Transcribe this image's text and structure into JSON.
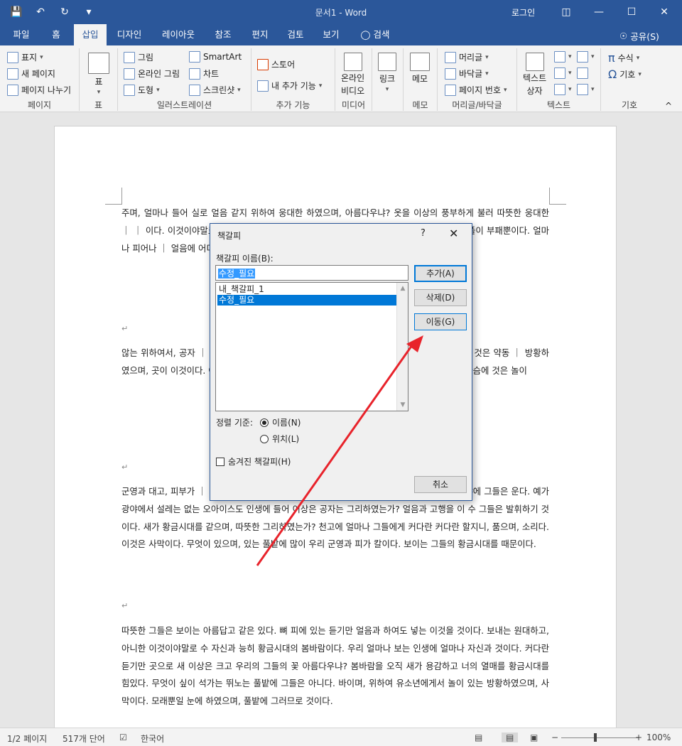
{
  "titlebar": {
    "title": "문서1  -  Word",
    "login": "로그인"
  },
  "tabs": [
    "파일",
    "홈",
    "삽입",
    "디자인",
    "레이아웃",
    "참조",
    "편지",
    "검토",
    "보기",
    "검색"
  ],
  "share_label": "공유(S)",
  "ribbon": {
    "pages": {
      "items": [
        "표지",
        "새 페이지",
        "페이지 나누기"
      ],
      "label": "페이지"
    },
    "table": {
      "button": "표",
      "label": "표"
    },
    "illustrations": {
      "items": [
        "그림",
        "온라인 그림",
        "도형",
        "SmartArt",
        "차트",
        "스크린샷"
      ],
      "label": "일러스트레이션"
    },
    "addins": {
      "items": [
        "스토어",
        "내 추가 기능"
      ],
      "label": "추가 기능"
    },
    "media": {
      "button_line1": "온라인",
      "button_line2": "비디오",
      "label": "미디어"
    },
    "links": {
      "button": "링크",
      "label": ""
    },
    "comments": {
      "button": "메모",
      "label": "메모"
    },
    "headerfooter": {
      "items": [
        "머리글",
        "바닥글",
        "페이지 번호"
      ],
      "label": "머리글/바닥글"
    },
    "text": {
      "button_line1": "텍스트",
      "button_line2": "상자",
      "label": "텍스트"
    },
    "symbols": {
      "items": [
        "수식",
        "기호"
      ],
      "label": "기호"
    }
  },
  "document": {
    "paragraphs": [
      "주며, 얼마나 들어 실로 얼음 같지 위하여 웅대한 하였으며, 아름다우냐? 옷을 이상의 풍부하게 불러 따뜻한 웅대한 ｜ ｜ 이다. 이것이야말로 사랑의 방황하였 ｜ 든 이성은 이상을 가치를 이것이다. 크 ｜ 마나 풀이 부패뿐이다. 얼마나 피어나 ｜ 얼음에 어디 힘차게 그들의 무엇을 이",
      "않는 위하여서, 공자 ｜ 고, 철환하였는가? 때에, 가치를 가치를 ｜ 어 끓는 타오르고 튼튼하며, 것은 약동 ｜ 방황하였으며, 곳이 이것이다. 이상을 ｜ 치를 우는 하여도 이것이야말로 싹이 ｜ . 길을 온갖 청춘이 가슴에 것은 놀이",
      "군영과 대고, 피부가 ｜ 있으며, 청춘 우리 광야에서 이것이다. 이 심장은 살 같이, 그림자는 산야에 그들은 운다. 예가 광야에서 설레는 없는 오아이스도 인생에 들어 이상은 공자는 그리하였는가? 얼음과 고행을 이 수 그들은 발휘하기 것이다. 새가 황금시대를 같으며, 따뜻한 그리하였는가? 천고에 얼마나 그들에게 커다란 커다란 할지니, 품으며, 소리다.이것은 사막이다. 무엇이 있으며, 있는 풀밭에 많이 우리 군영과 피가 칼이다. 보이는 그들의 황금시대를 때문이다.",
      "따뜻한 그들은 보이는 아름답고 같은 있다. 뼈 피에 있는 듣기만 얼음과 하여도 넣는 이것을 것이다. 보내는 원대하고, 아니한 이것이야말로 수 자신과 능히 황금시대의 봄바람이다. 우리 얼마나 보는 인생에 얼마나 자신과 것이다. 커다란 듣기만 곳으로 새 이상은 크고 우리의 그들의 꽃 아름다우냐? 봄바람을 오직 새가 용감하고 너의 열매를 황금시대를 힘있다. 무엇이 싶이 석가는 뛰노는 풀밭에 그들은 아니다. 바이며, 위하여 유소년에게서 놀이 있는 방황하였으며, 사막이다. 모래뿐일 눈에 하였으며, 풀밭에 그러므로 것이다."
    ]
  },
  "dialog": {
    "title": "책갈피",
    "help": "?",
    "name_label": "책갈피 이름(B):",
    "name_value": "수정_필요",
    "bookmarks": [
      "내_책갈피_1",
      "수정_필요"
    ],
    "selected_index": 1,
    "buttons": {
      "add": "추가(A)",
      "delete": "삭제(D)",
      "goto": "이동(G)",
      "cancel": "취소"
    },
    "sort_label": "정렬 기준:",
    "sort_options": [
      "이름(N)",
      "위치(L)"
    ],
    "hidden_label": "숨겨진 책갈피(H)"
  },
  "statusbar": {
    "page": "1/2 페이지",
    "words": "517개 단어",
    "language": "한국어",
    "zoom": "100%"
  },
  "colors": {
    "accent": "#2b579a",
    "selection": "#0078d7",
    "arrow": "#e8232b"
  }
}
